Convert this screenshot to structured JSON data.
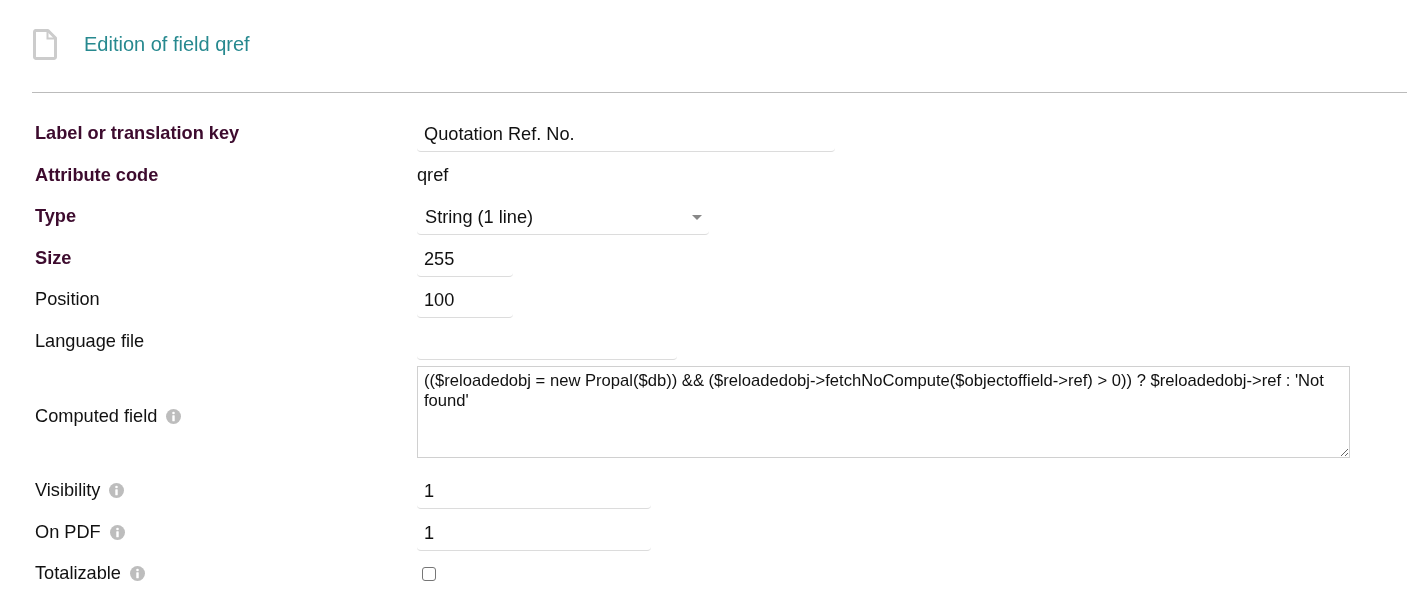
{
  "header": {
    "title": "Edition of field qref"
  },
  "fields": [
    {
      "label": "Label or translation key",
      "required": true,
      "help": false,
      "kind": "text",
      "value": "Quotation Ref. No."
    },
    {
      "label": "Attribute code",
      "required": true,
      "help": false,
      "kind": "static",
      "value": "qref"
    },
    {
      "label": "Type",
      "required": true,
      "help": false,
      "kind": "select",
      "value": "String (1 line)"
    },
    {
      "label": "Size",
      "required": true,
      "help": false,
      "kind": "text",
      "value": "255"
    },
    {
      "label": "Position",
      "required": false,
      "help": false,
      "kind": "text",
      "value": "100"
    },
    {
      "label": "Language file",
      "required": false,
      "help": false,
      "kind": "text"
    },
    {
      "label": "Computed field",
      "required": false,
      "help": true,
      "kind": "textarea",
      "value": "(($reloadedobj = new Propal($db)) && ($reloadedobj->fetchNoCompute($objectoffield->ref) > 0)) ? $reloadedobj->ref : 'Not found'"
    },
    {
      "label": "Visibility",
      "required": false,
      "help": true,
      "kind": "text",
      "value": "1"
    },
    {
      "label": "On PDF",
      "required": false,
      "help": true,
      "kind": "text",
      "value": "1"
    },
    {
      "label": "Totalizable",
      "required": false,
      "help": true,
      "kind": "checkbox",
      "checked": false
    }
  ]
}
